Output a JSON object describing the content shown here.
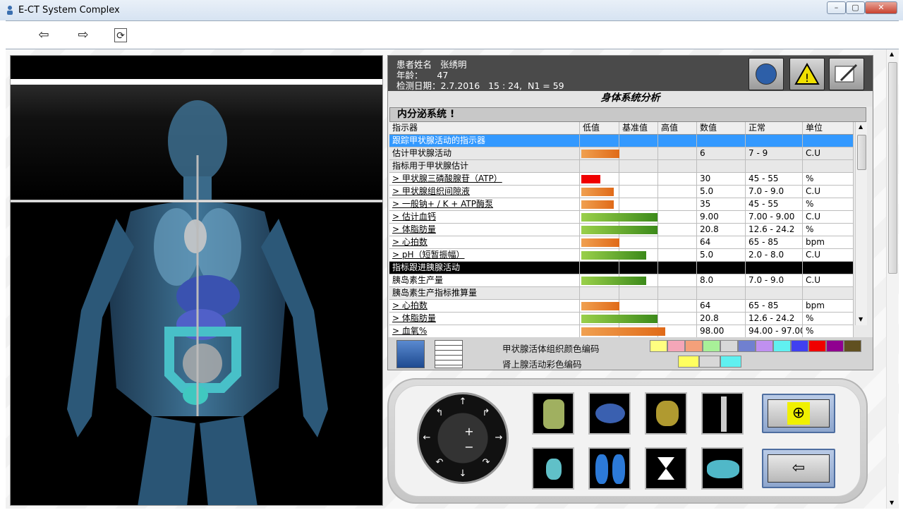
{
  "window": {
    "title": "E-CT System Complex",
    "min": "–",
    "max": "▢",
    "close": "✕"
  },
  "toolbar": {
    "back": "⇦",
    "forward": "⇨",
    "refresh": "⟳"
  },
  "patient": {
    "name_label": "患者姓名",
    "name": "张绣明",
    "age_label": "年龄：",
    "age": "47",
    "date_line": "检测日期：2.7.2016   15 : 24,  N1 = 59"
  },
  "section_title": "身体系统分析",
  "system_title": "内分泌系统        !",
  "table": {
    "headers": [
      "指示器",
      "低值",
      "基准值",
      "高值",
      "数值",
      "正常",
      "单位"
    ],
    "rows": [
      {
        "label": "跟踪甲状腺活动的指示器",
        "style": "selected",
        "value": "",
        "normal": "",
        "unit": "",
        "bar": null
      },
      {
        "label": "估计甲状腺活动",
        "style": "group",
        "value": "6",
        "normal": "7 - 9",
        "unit": "C.U",
        "bar": {
          "color": "orange",
          "len": 1.0
        }
      },
      {
        "label": "指标用于甲状腺估计",
        "style": "group",
        "value": "",
        "normal": "",
        "unit": "",
        "bar": null
      },
      {
        "label": ">        甲状腺三磷酸腺苷（ATP）",
        "style": "link",
        "value": "30",
        "normal": "45 - 55",
        "unit": "%",
        "bar": {
          "color": "red",
          "len": 0.5
        }
      },
      {
        "label": ">        甲状腺组织间隙液",
        "style": "link",
        "value": "5.0",
        "normal": "7.0 - 9.0",
        "unit": "C.U",
        "bar": {
          "color": "orange",
          "len": 0.85
        }
      },
      {
        "label": ">        一般钠+ / K + ATP酶泵",
        "style": "link",
        "value": "35",
        "normal": "45 - 55",
        "unit": "%",
        "bar": {
          "color": "orange",
          "len": 0.85
        }
      },
      {
        "label": ">        估计血钙",
        "style": "link",
        "value": "9.00",
        "normal": "7.00 - 9.00",
        "unit": "C.U",
        "bar": {
          "color": "green",
          "len": 2.0
        }
      },
      {
        "label": ">        体脂肪量",
        "style": "link",
        "value": "20.8",
        "normal": "12.6 - 24.2",
        "unit": "%",
        "bar": {
          "color": "green",
          "len": 2.0
        }
      },
      {
        "label": ">        心拍数",
        "style": "link",
        "value": "64",
        "normal": "65 - 85",
        "unit": "bpm",
        "bar": {
          "color": "orange",
          "len": 1.0
        }
      },
      {
        "label": ">        pH（短暂振幅）",
        "style": "link",
        "value": "5.0",
        "normal": "2.0 - 8.0",
        "unit": "C.U",
        "bar": {
          "color": "green",
          "len": 1.7
        }
      },
      {
        "label": "指标跟进胰腺活动",
        "style": "dark",
        "value": "",
        "normal": "",
        "unit": "",
        "bar": null
      },
      {
        "label": "胰岛素生产量",
        "style": "plain",
        "value": "8.0",
        "normal": "7.0 - 9.0",
        "unit": "C.U",
        "bar": {
          "color": "green",
          "len": 1.7
        }
      },
      {
        "label": "胰岛素生产指标推算量",
        "style": "group",
        "value": "",
        "normal": "",
        "unit": "",
        "bar": null
      },
      {
        "label": ">        心拍数",
        "style": "link",
        "value": "64",
        "normal": "65 - 85",
        "unit": "bpm",
        "bar": {
          "color": "orange",
          "len": 1.0
        }
      },
      {
        "label": ">        体脂肪量",
        "style": "link",
        "value": "20.8",
        "normal": "12.6 - 24.2",
        "unit": "%",
        "bar": {
          "color": "green",
          "len": 2.0
        }
      },
      {
        "label": ">        血氧%",
        "style": "link",
        "value": "98.00",
        "normal": "94.00 - 97.00",
        "unit": "%",
        "bar": {
          "color": "orange",
          "len": 2.2
        }
      }
    ]
  },
  "legend": {
    "thyroid_label": "甲状腺活体组织颜色编码",
    "adrenal_label": "肾上腺活动彩色编码",
    "thyroid_colors": [
      "#ffff80",
      "#f4a6b8",
      "#f4a07a",
      "#a8f098",
      "#d8d8d8",
      "#7080d0",
      "#c090f0",
      "#60f0f0",
      "#4040f0",
      "#f00000",
      "#900090",
      "#605020"
    ],
    "adrenal_colors": [
      "#ffff60",
      "#d8d8d8",
      "#60f0f0"
    ]
  },
  "nav": {
    "dial": {
      "up": "↑",
      "down": "↓",
      "left": "←",
      "right": "→",
      "plus": "+",
      "minus": "−",
      "ul": "↰",
      "ur": "↱",
      "dl": "↶",
      "dr": "↷"
    },
    "back_label": "⇦",
    "target_label": "⊕"
  }
}
